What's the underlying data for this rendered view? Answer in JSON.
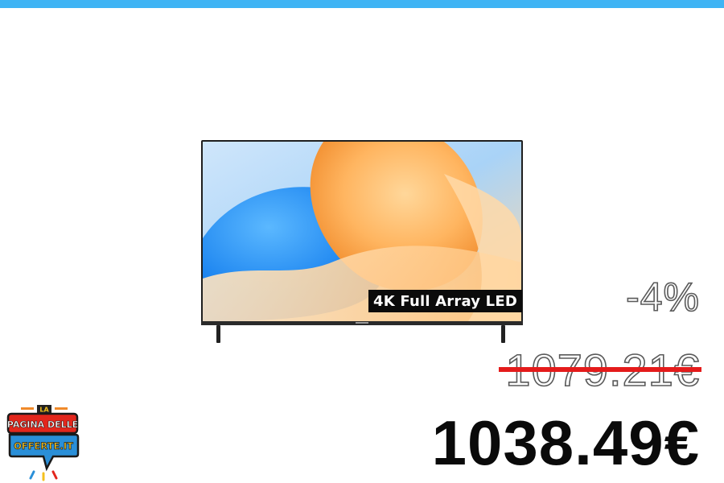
{
  "colors": {
    "top_bar": "#3fb4f4",
    "strike": "#e41b1b",
    "price": "#0a0a0a",
    "outline_text": "#5a5a5a",
    "logo_red": "#e2261c",
    "logo_blue": "#2a8fd8",
    "logo_yellow": "#f4c01e"
  },
  "product": {
    "image_icon": "tv-icon",
    "badge_text": "4K Full Array LED"
  },
  "pricing": {
    "discount": "-4%",
    "old_price": "1079.21€",
    "new_price": "1038.49€"
  },
  "logo": {
    "line1": "LA",
    "line2": "PAGINA DELLE",
    "line3": "OFFERTE.IT"
  }
}
